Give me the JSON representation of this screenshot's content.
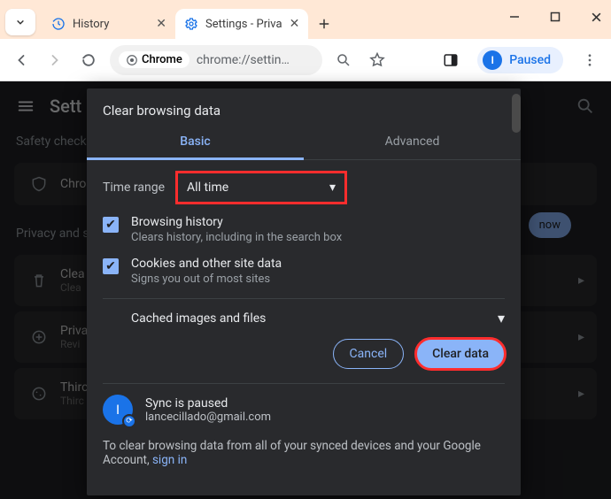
{
  "window": {
    "tabs": [
      {
        "title": "History",
        "favicon": "history-icon"
      },
      {
        "title": "Settings - Priva",
        "favicon": "gear-icon"
      }
    ],
    "active_tab_index": 1
  },
  "toolbar": {
    "omnibox_chip": "Chrome",
    "omnibox_url": "chrome://settin…",
    "profile_label": "Paused",
    "profile_initial": "I"
  },
  "settings_bg": {
    "title": "Sett",
    "safety_label": "Safety check",
    "safety_item": "Chro",
    "check_now": "now",
    "privacy_label": "Privacy and s",
    "items": [
      {
        "title": "Clea",
        "sub": "Clea"
      },
      {
        "title": "Priva",
        "sub": "Revi"
      },
      {
        "title": "Thirc",
        "sub": "Thirc"
      }
    ]
  },
  "dialog": {
    "title": "Clear browsing data",
    "tabs": {
      "basic": "Basic",
      "advanced": "Advanced"
    },
    "time_label": "Time range",
    "time_value": "All time",
    "options": [
      {
        "title": "Browsing history",
        "sub": "Clears history, including in the search box",
        "checked": true
      },
      {
        "title": "Cookies and other site data",
        "sub": "Signs you out of most sites",
        "checked": true
      },
      {
        "title": "Cached images and files",
        "sub": "",
        "checked": null
      }
    ],
    "cancel": "Cancel",
    "clear": "Clear data",
    "sync": {
      "initial": "I",
      "line1": "Sync is paused",
      "line2": "lancecillado@gmail.com"
    },
    "footnote_a": "To clear browsing data from all of your synced devices and your Google Account, ",
    "footnote_link": "sign in"
  }
}
